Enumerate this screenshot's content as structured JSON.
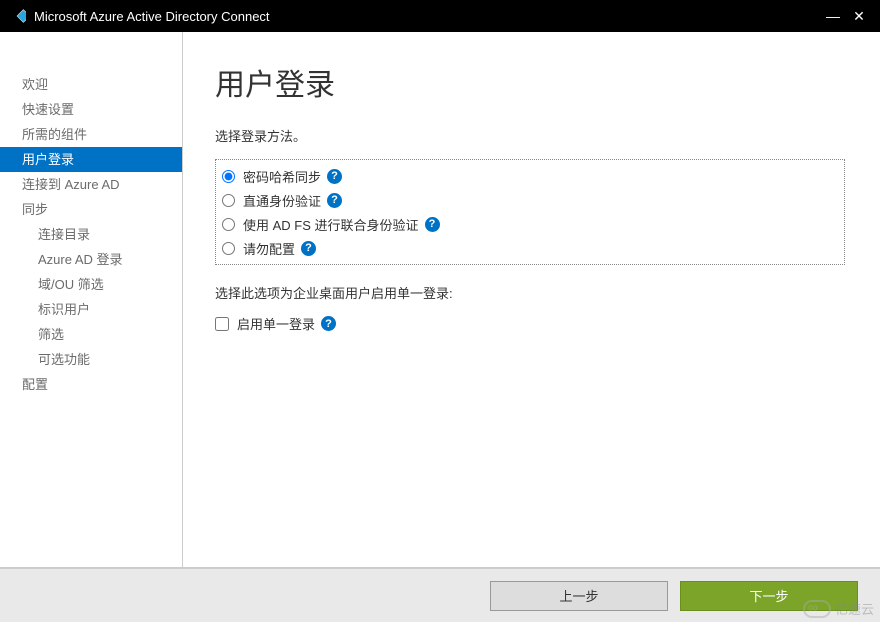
{
  "titlebar": {
    "title": "Microsoft Azure Active Directory Connect"
  },
  "sidebar": {
    "items": [
      {
        "label": "欢迎",
        "indent": 0,
        "active": false
      },
      {
        "label": "快速设置",
        "indent": 0,
        "active": false
      },
      {
        "label": "所需的组件",
        "indent": 0,
        "active": false
      },
      {
        "label": "用户登录",
        "indent": 0,
        "active": true
      },
      {
        "label": "连接到 Azure AD",
        "indent": 0,
        "active": false
      },
      {
        "label": "同步",
        "indent": 0,
        "active": false
      },
      {
        "label": "连接目录",
        "indent": 1,
        "active": false
      },
      {
        "label": "Azure AD 登录",
        "indent": 1,
        "active": false
      },
      {
        "label": "域/OU 筛选",
        "indent": 1,
        "active": false
      },
      {
        "label": "标识用户",
        "indent": 1,
        "active": false
      },
      {
        "label": "筛选",
        "indent": 1,
        "active": false
      },
      {
        "label": "可选功能",
        "indent": 1,
        "active": false
      },
      {
        "label": "配置",
        "indent": 0,
        "active": false
      }
    ]
  },
  "main": {
    "page_title": "用户登录",
    "signin_prompt": "选择登录方法。",
    "options": [
      {
        "label": "密码哈希同步",
        "checked": true
      },
      {
        "label": "直通身份验证",
        "checked": false
      },
      {
        "label": "使用 AD FS 进行联合身份验证",
        "checked": false
      },
      {
        "label": "请勿配置",
        "checked": false
      }
    ],
    "sso_prompt": "选择此选项为企业桌面用户启用单一登录:",
    "sso_checkbox_label": "启用单一登录",
    "sso_checked": false
  },
  "footer": {
    "prev": "上一步",
    "next": "下一步"
  },
  "watermark": "亿速云"
}
